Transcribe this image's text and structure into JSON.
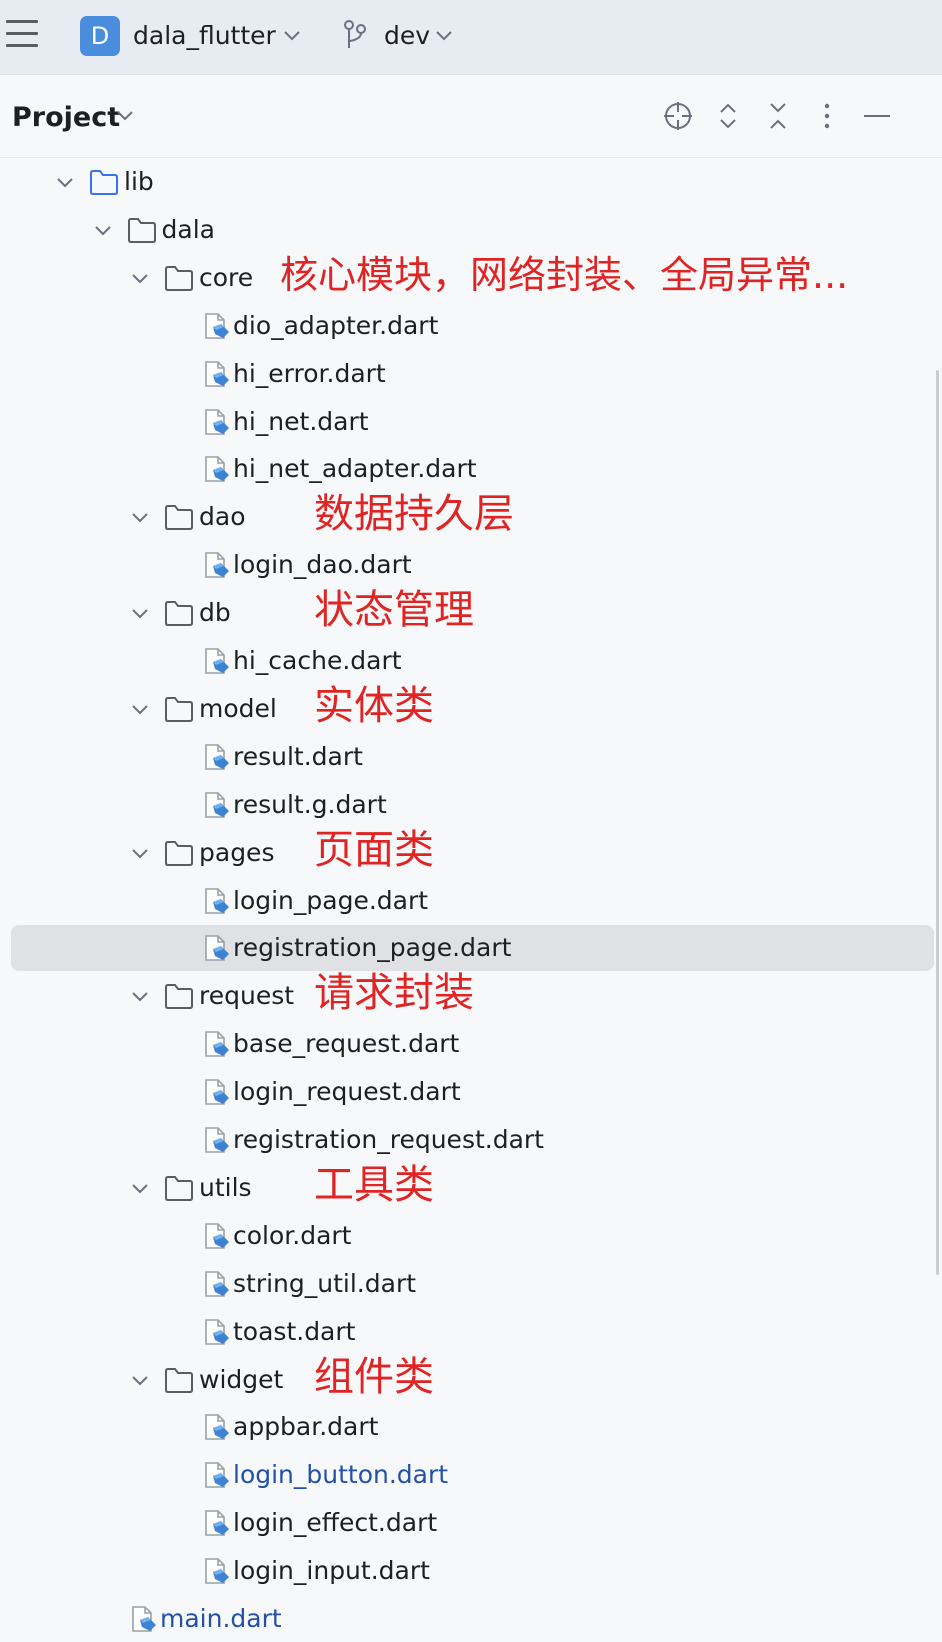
{
  "titlebar": {
    "project_badge": "D",
    "project_name": "dala_flutter",
    "branch": "dev"
  },
  "toolwindow": {
    "title": "Project",
    "icons": [
      "locate-icon",
      "expand-all-icon",
      "collapse-all-icon",
      "more-icon",
      "minimize-icon"
    ]
  },
  "tree": [
    {
      "label": "lib",
      "type": "folder",
      "depth": 1,
      "expanded": true,
      "note": ""
    },
    {
      "label": "dala",
      "type": "folder",
      "depth": 2,
      "expanded": true,
      "note": ""
    },
    {
      "label": "core",
      "type": "folder",
      "depth": 3,
      "expanded": true,
      "note": "核心模块，网络封装、全局异常..."
    },
    {
      "label": "dio_adapter.dart",
      "type": "file",
      "depth": 4,
      "note": ""
    },
    {
      "label": "hi_error.dart",
      "type": "file",
      "depth": 4,
      "note": ""
    },
    {
      "label": "hi_net.dart",
      "type": "file",
      "depth": 4,
      "note": ""
    },
    {
      "label": "hi_net_adapter.dart",
      "type": "file",
      "depth": 4,
      "note": ""
    },
    {
      "label": "dao",
      "type": "folder",
      "depth": 3,
      "expanded": true,
      "note": "数据持久层"
    },
    {
      "label": "login_dao.dart",
      "type": "file",
      "depth": 4,
      "note": ""
    },
    {
      "label": "db",
      "type": "folder",
      "depth": 3,
      "expanded": true,
      "note": "状态管理"
    },
    {
      "label": "hi_cache.dart",
      "type": "file",
      "depth": 4,
      "note": ""
    },
    {
      "label": "model",
      "type": "folder",
      "depth": 3,
      "expanded": true,
      "note": "实体类"
    },
    {
      "label": "result.dart",
      "type": "file",
      "depth": 4,
      "note": ""
    },
    {
      "label": "result.g.dart",
      "type": "file",
      "depth": 4,
      "note": ""
    },
    {
      "label": "pages",
      "type": "folder",
      "depth": 3,
      "expanded": true,
      "note": "页面类"
    },
    {
      "label": "login_page.dart",
      "type": "file",
      "depth": 4,
      "note": ""
    },
    {
      "label": "registration_page.dart",
      "type": "file",
      "depth": 4,
      "selected": true,
      "note": ""
    },
    {
      "label": "request",
      "type": "folder",
      "depth": 3,
      "expanded": true,
      "note": "请求封装"
    },
    {
      "label": "base_request.dart",
      "type": "file",
      "depth": 4,
      "note": ""
    },
    {
      "label": "login_request.dart",
      "type": "file",
      "depth": 4,
      "note": ""
    },
    {
      "label": "registration_request.dart",
      "type": "file",
      "depth": 4,
      "note": ""
    },
    {
      "label": "utils",
      "type": "folder",
      "depth": 3,
      "expanded": true,
      "note": "工具类"
    },
    {
      "label": "color.dart",
      "type": "file",
      "depth": 4,
      "note": ""
    },
    {
      "label": "string_util.dart",
      "type": "file",
      "depth": 4,
      "note": ""
    },
    {
      "label": "toast.dart",
      "type": "file",
      "depth": 4,
      "note": ""
    },
    {
      "label": "widget",
      "type": "folder",
      "depth": 3,
      "expanded": true,
      "note": "组件类"
    },
    {
      "label": "appbar.dart",
      "type": "file",
      "depth": 4,
      "note": ""
    },
    {
      "label": "login_button.dart",
      "type": "file",
      "depth": 4,
      "modified": true,
      "note": ""
    },
    {
      "label": "login_effect.dart",
      "type": "file",
      "depth": 4,
      "note": ""
    },
    {
      "label": "login_input.dart",
      "type": "file",
      "depth": 4,
      "note": ""
    },
    {
      "label": "main.dart",
      "type": "file",
      "depth": 2,
      "modified": true,
      "note": ""
    }
  ],
  "colors": {
    "note_red": "#e02424",
    "modified_blue": "#2451a6",
    "selection": "#dfe1e5",
    "badge": "#4a8ddc"
  }
}
